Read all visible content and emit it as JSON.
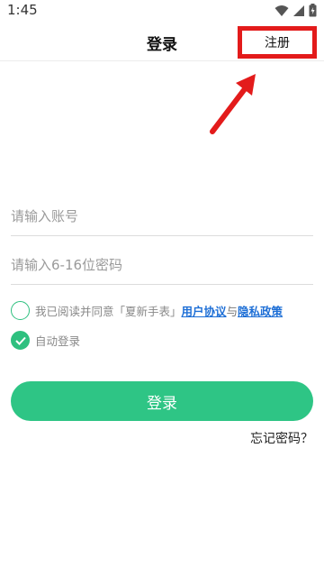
{
  "status_bar": {
    "time": "1:45"
  },
  "header": {
    "title": "登录",
    "register_label": "注册"
  },
  "form": {
    "account_placeholder": "请输入账号",
    "password_placeholder": "请输入6-16位密码"
  },
  "agreement": {
    "prefix": "我已阅读并同意「夏新手表」",
    "user_agreement": "用户协议",
    "and": "与",
    "privacy_policy": "隐私政策",
    "checked": false
  },
  "auto_login": {
    "label": "自动登录",
    "checked": true
  },
  "login_button": "登录",
  "forgot_password": "忘记密码？",
  "colors": {
    "accent": "#2ec585",
    "link": "#1e6fd6",
    "highlight": "#e31b1b"
  }
}
